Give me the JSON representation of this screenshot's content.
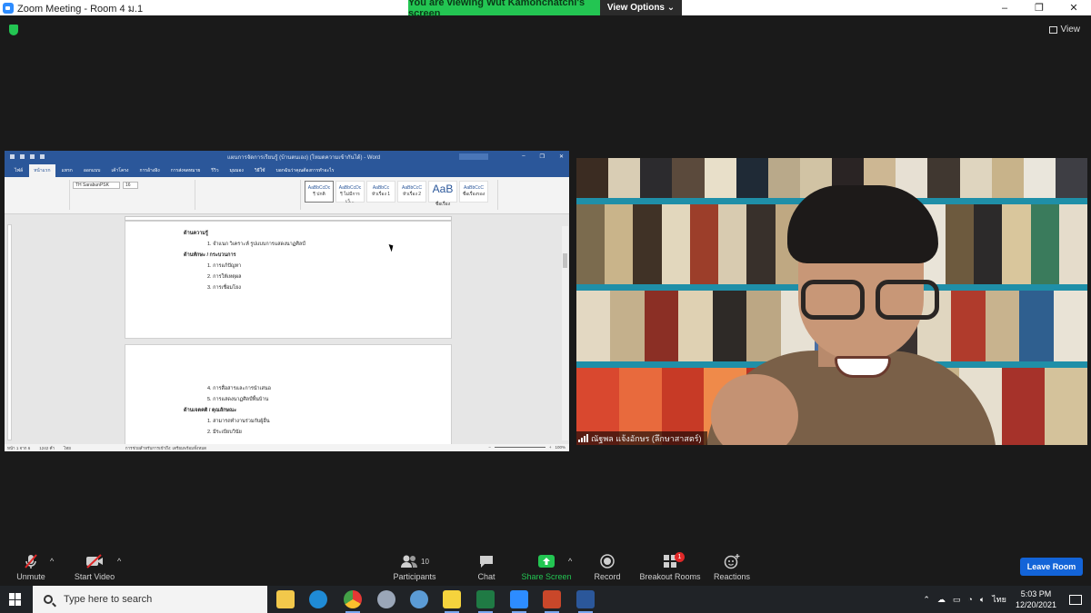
{
  "window": {
    "title": "Zoom Meeting - Room 4 ม.1",
    "controls": [
      "–",
      "❐",
      "✕"
    ]
  },
  "share_banner": {
    "viewing_text": "You are viewing Wut Kamonchatchi's screen",
    "view_options": "View Options ⌄"
  },
  "view_button": {
    "label": "View"
  },
  "word": {
    "doc_title": "แผนการจัดการเรียนรู้ (บ้านตนเอง) (โหมดความเข้ากันได้) - Word",
    "tabs": [
      "ไฟล์",
      "หน้าแรก",
      "แทรก",
      "ออกแบบ",
      "เค้าโครง",
      "การอ้างอิง",
      "การส่งจดหมาย",
      "รีวิว",
      "มุมมอง",
      "วิธีใช้",
      "บอกฉันว่าคุณต้องการทำอะไร"
    ],
    "font_name": "TH SarabunPSK",
    "font_size": "16",
    "styles": [
      "AaBbCcDc",
      "AaBbCcDc",
      "AaBbCc",
      "AaBbCcC",
      "AaB",
      "AaBbCcC"
    ],
    "style_names": [
      "¶ ปกติ",
      "¶ ไม่มีการเว้…",
      "หัวเรื่อง 1",
      "หัวเรื่อง 2",
      "ชื่อเรื่อง",
      "ชื่อเรื่องรอง"
    ],
    "page1_lines": [
      "ด้านความรู้",
      "1. จำแนก วิเคราะห์ รูปแบบการแสดงนาฏศิลป์",
      "ด้านทักษะ / กระบวนการ",
      "1. การแก้ปัญหา",
      "2. การให้เหตุผล",
      "3. การเชื่อมโยง"
    ],
    "page2_lines": [
      "4. การสื่อสารและการนำเสนอ",
      "5. การแสดงนาฏศิลป์พื้นบ้าน",
      "ด้านเจตคติ / คุณลักษณะ",
      "1. สามารถทำงานร่วมกับผู้อื่น",
      "2. มีระเบียบวินัย"
    ],
    "status": {
      "page": "หน้า 1 จาก 6",
      "words": "1242 คำ",
      "lang": "ไทย",
      "accessibility": "การช่วยสำหรับการเข้าถึง: เตรียมพร้อมทั้งหมด",
      "zoom": "100%"
    }
  },
  "video": {
    "participant_name": "ณัฐพล แจ้งอักษร (ลึกษาสาสตร์)"
  },
  "toolbar": {
    "unmute": "Unmute",
    "start_video": "Start Video",
    "participants": "Participants",
    "participants_count": "10",
    "chat": "Chat",
    "share_screen": "Share Screen",
    "record": "Record",
    "breakout_rooms": "Breakout Rooms",
    "breakout_badge": "1",
    "reactions": "Reactions",
    "leave_room": "Leave Room",
    "caret": "^"
  },
  "taskbar": {
    "search_placeholder": "Type here to search",
    "apps": [
      "file-explorer",
      "edge",
      "chrome",
      "app-4",
      "app-5",
      "sticky-notes",
      "excel",
      "zoom",
      "powerpoint",
      "word"
    ],
    "language": "ไทย",
    "time": "5:03 PM",
    "date": "12/20/2021"
  },
  "colors": {
    "zoom_green": "#23c552",
    "zoom_blue": "#2d8cff",
    "word_blue": "#2b579a",
    "leave_blue": "#1364d8",
    "badge_red": "#e02828"
  }
}
